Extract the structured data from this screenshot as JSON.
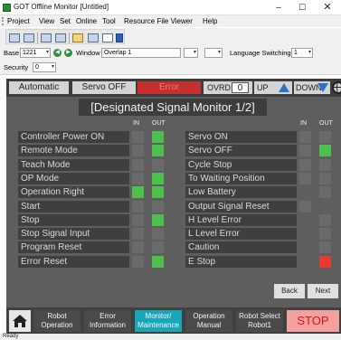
{
  "window": {
    "title": "GOT Offline Monitor [Untitled]",
    "minimize": "–",
    "maximize": "☐",
    "close": "✕"
  },
  "menu": {
    "items": [
      "Project",
      "View",
      "Set",
      "Online",
      "Tool",
      "Resource File Viewer",
      "Help"
    ]
  },
  "baserow": {
    "base_label": "Base",
    "base_value": "1221",
    "window_label": "Window",
    "window_value": "Overlap 1",
    "language_label": "Language Switching",
    "language_value": "1"
  },
  "security": {
    "label": "Security",
    "value": "0"
  },
  "hmi": {
    "status": {
      "mode": "Automatic",
      "servo": "Servo OFF",
      "error": "Error",
      "ovrd_label": "OVRD",
      "ovrd_value": "0",
      "up": "UP",
      "down": "DOWN"
    },
    "title": "[Designated Signal Monitor 1/2]",
    "headers": {
      "in": "IN",
      "out": "OUT"
    },
    "left_signals": [
      {
        "label": "Controller Power ON",
        "in": "off",
        "out": "on"
      },
      {
        "label": "Remote Mode",
        "in": "off",
        "out": "on"
      },
      {
        "label": "Teach Mode",
        "in": "off",
        "out": "off"
      },
      {
        "label": "OP Mode",
        "in": "off",
        "out": "on"
      },
      {
        "label": "Operation Right",
        "in": "on",
        "out": "on"
      },
      {
        "label": "Start",
        "in": "off",
        "out": "off"
      },
      {
        "label": "Stop",
        "in": "off",
        "out": "on"
      },
      {
        "label": "Stop Signal Input",
        "in": "off",
        "out": "off"
      },
      {
        "label": "Program Reset",
        "in": "off",
        "out": "off"
      },
      {
        "label": "Error Reset",
        "in": "off",
        "out": "on"
      }
    ],
    "right_signals": [
      {
        "label": "Servo ON",
        "in": "off",
        "out": "off"
      },
      {
        "label": "Servo OFF",
        "in": "off",
        "out": "on"
      },
      {
        "label": "Cycle Stop",
        "in": "off",
        "out": "off"
      },
      {
        "label": "To Waiting Position",
        "in": "off",
        "out": "off"
      },
      {
        "label": "Low Battery",
        "in": "none",
        "out": "off"
      },
      {
        "label": "Output Signal Reset",
        "in": "off",
        "out": "none"
      },
      {
        "label": "H Level Error",
        "in": "none",
        "out": "off"
      },
      {
        "label": "L Level Error",
        "in": "none",
        "out": "off"
      },
      {
        "label": "Caution",
        "in": "none",
        "out": "off"
      },
      {
        "label": "E Stop",
        "in": "none",
        "out": "error"
      }
    ],
    "back_label": "Back",
    "next_label": "Next",
    "nav": [
      {
        "line1": "Robot",
        "line2": "Operation"
      },
      {
        "line1": "Error",
        "line2": "Information"
      },
      {
        "line1": "Monitor/",
        "line2": "Maintenance"
      },
      {
        "line1": "Operation",
        "line2": "Manual"
      },
      {
        "line1": "Robot Select",
        "line2": "Robot1"
      }
    ],
    "stop_label": "STOP"
  },
  "statusbar": {
    "text": "Ready"
  },
  "colors": {
    "lamp_on": "#4cc04c",
    "lamp_off": "#6a6a6a",
    "lamp_error": "#e83a2e",
    "active_tab": "#19a7b8",
    "error_box": "#c43030"
  },
  "icons": {
    "home": "home-icon",
    "globe": "globe-icon",
    "up": "up-triangle-icon",
    "down": "down-triangle-icon"
  }
}
